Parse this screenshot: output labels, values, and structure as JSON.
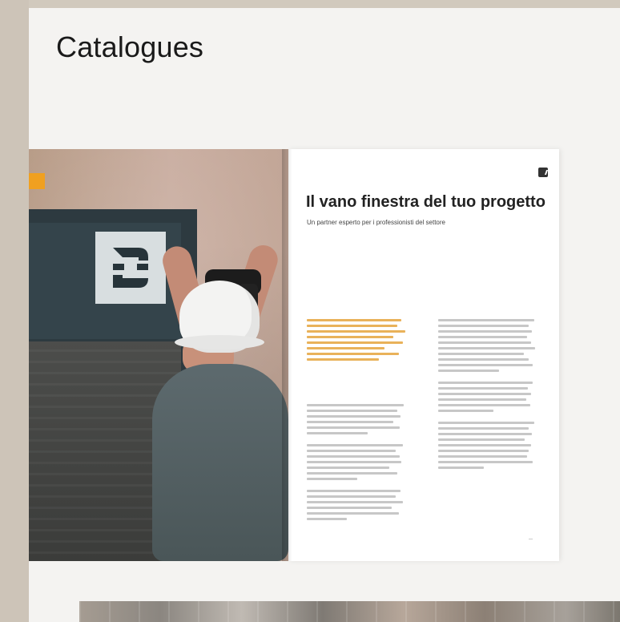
{
  "page": {
    "title": "Catalogues"
  },
  "catalogue": {
    "right_page": {
      "title": "Il vano finestra del tuo progetto",
      "subtitle": "Un partner esperto per i professionisti del settore"
    }
  },
  "colors": {
    "background": "#d1c9bd",
    "panel": "#f4f3f1",
    "accent": "#e2a23b",
    "text": "#1a1a1a"
  },
  "icons": [
    "brand-logo-icon",
    "corner-logo-icon"
  ]
}
